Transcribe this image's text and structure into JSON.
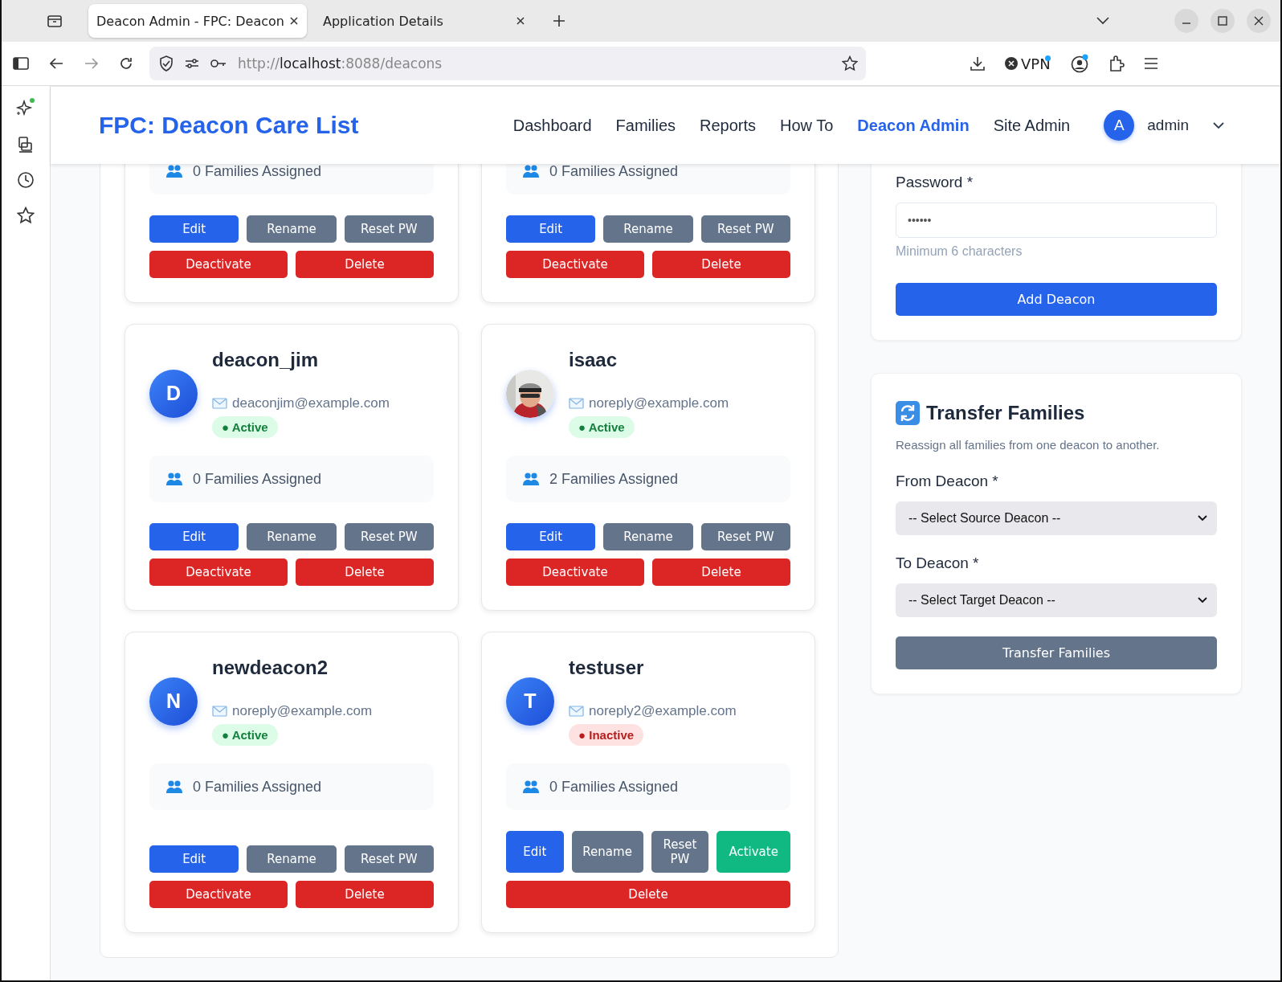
{
  "browser": {
    "tabs": [
      {
        "title": "Deacon Admin - FPC: Deacon",
        "selected": true
      },
      {
        "title": "Application Details",
        "selected": false
      }
    ],
    "url": {
      "scheme": "http://",
      "host": "localhost",
      "rest": ":8088/deacons"
    },
    "vpn": "VPN"
  },
  "header": {
    "brand": "FPC: Deacon Care List",
    "nav": [
      {
        "label": "Dashboard",
        "selected": false
      },
      {
        "label": "Families",
        "selected": false
      },
      {
        "label": "Reports",
        "selected": false
      },
      {
        "label": "How To",
        "selected": false
      },
      {
        "label": "Deacon Admin",
        "selected": true
      },
      {
        "label": "Site Admin",
        "selected": false
      }
    ],
    "user": {
      "initial": "A",
      "name": "admin"
    }
  },
  "deacons": [
    {
      "families": "0 Families Assigned",
      "actions": [
        [
          {
            "label": "Edit",
            "kind": "primary"
          },
          {
            "label": "Rename",
            "kind": "secondary"
          },
          {
            "label": "Reset PW",
            "kind": "secondary"
          }
        ],
        [
          {
            "label": "Deactivate",
            "kind": "danger"
          },
          {
            "label": "Delete",
            "kind": "danger"
          }
        ]
      ]
    },
    {
      "families": "0 Families Assigned",
      "actions": [
        [
          {
            "label": "Edit",
            "kind": "primary"
          },
          {
            "label": "Rename",
            "kind": "secondary"
          },
          {
            "label": "Reset PW",
            "kind": "secondary"
          }
        ],
        [
          {
            "label": "Deactivate",
            "kind": "danger"
          },
          {
            "label": "Delete",
            "kind": "danger"
          }
        ]
      ]
    },
    {
      "name": "deacon_jim",
      "avatar": {
        "kind": "initial",
        "initial": "D"
      },
      "email": "deaconjim@example.com",
      "status": {
        "label": "● Active",
        "active": true
      },
      "families": "0 Families Assigned",
      "actions": [
        [
          {
            "label": "Edit",
            "kind": "primary"
          },
          {
            "label": "Rename",
            "kind": "secondary"
          },
          {
            "label": "Reset PW",
            "kind": "secondary"
          }
        ],
        [
          {
            "label": "Deactivate",
            "kind": "danger"
          },
          {
            "label": "Delete",
            "kind": "danger"
          }
        ]
      ]
    },
    {
      "name": "isaac",
      "avatar": {
        "kind": "picture"
      },
      "email": "noreply@example.com",
      "status": {
        "label": "● Active",
        "active": true
      },
      "families": "2 Families Assigned",
      "actions": [
        [
          {
            "label": "Edit",
            "kind": "primary"
          },
          {
            "label": "Rename",
            "kind": "secondary"
          },
          {
            "label": "Reset PW",
            "kind": "secondary"
          }
        ],
        [
          {
            "label": "Deactivate",
            "kind": "danger"
          },
          {
            "label": "Delete",
            "kind": "danger"
          }
        ]
      ]
    },
    {
      "name": "newdeacon2",
      "avatar": {
        "kind": "initial",
        "initial": "N"
      },
      "email": "noreply@example.com",
      "status": {
        "label": "● Active",
        "active": true
      },
      "families": "0 Families Assigned",
      "actions": [
        [
          {
            "label": "Edit",
            "kind": "primary"
          },
          {
            "label": "Rename",
            "kind": "secondary"
          },
          {
            "label": "Reset PW",
            "kind": "secondary"
          }
        ],
        [
          {
            "label": "Deactivate",
            "kind": "danger"
          },
          {
            "label": "Delete",
            "kind": "danger"
          }
        ]
      ]
    },
    {
      "name": "testuser",
      "avatar": {
        "kind": "initial",
        "initial": "T"
      },
      "email": "noreply2@example.com",
      "status": {
        "label": "● Inactive",
        "active": false
      },
      "families": "0 Families Assigned",
      "actions": [
        [
          {
            "label": "Edit",
            "kind": "primary"
          },
          {
            "label": "Rename",
            "kind": "secondary"
          },
          {
            "label": "Reset PW",
            "kind": "secondary"
          },
          {
            "label": "Activate",
            "kind": "success"
          }
        ],
        [
          {
            "label": "Delete",
            "kind": "danger"
          }
        ]
      ]
    }
  ],
  "add_deacon": {
    "password_label": "Password *",
    "password_value": "••••••",
    "hint": "Minimum 6 characters",
    "button": "Add Deacon"
  },
  "transfer": {
    "title": "Transfer Families",
    "description": "Reassign all families from one deacon to another.",
    "from_label": "From Deacon *",
    "from_value": "-- Select Source Deacon --",
    "to_label": "To Deacon *",
    "to_value": "-- Select Target Deacon --",
    "button": "Transfer Families"
  }
}
